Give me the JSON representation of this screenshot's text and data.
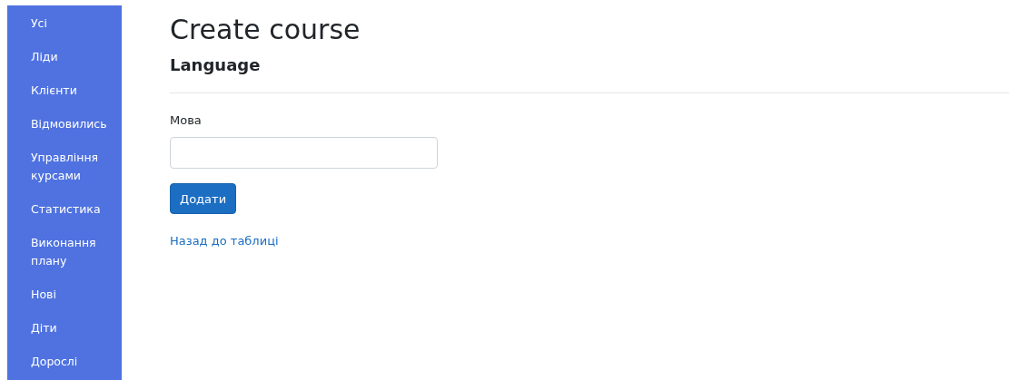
{
  "sidebar": {
    "items": [
      {
        "label": "Усі"
      },
      {
        "label": "Ліди"
      },
      {
        "label": "Клієнти"
      },
      {
        "label": "Відмовились"
      },
      {
        "label": "Управління курсами"
      },
      {
        "label": "Статистика"
      },
      {
        "label": "Виконання плану"
      },
      {
        "label": "Нові"
      },
      {
        "label": "Діти"
      },
      {
        "label": "Дорослі"
      }
    ]
  },
  "page": {
    "title": "Create course",
    "subtitle": "Language"
  },
  "form": {
    "field_label": "Мова",
    "submit": "Додати"
  },
  "back_link": "Назад до таблиці"
}
